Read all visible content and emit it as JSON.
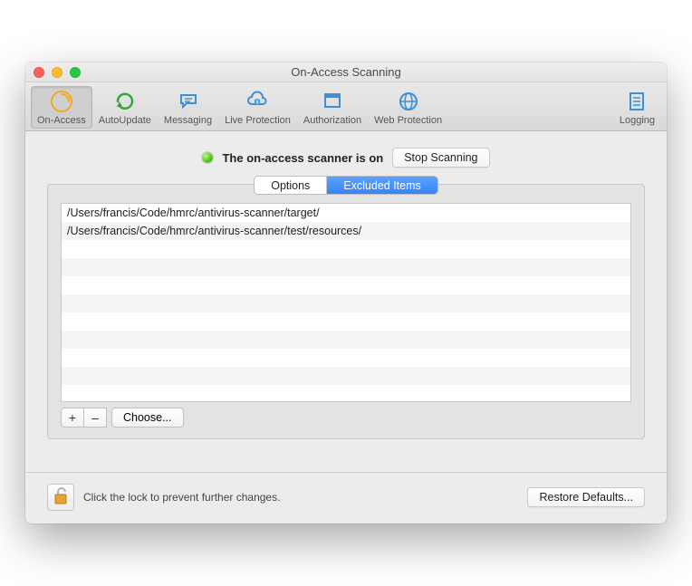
{
  "window": {
    "title": "On-Access Scanning"
  },
  "toolbar": {
    "items": [
      {
        "label": "On-Access",
        "selected": true
      },
      {
        "label": "AutoUpdate",
        "selected": false
      },
      {
        "label": "Messaging",
        "selected": false
      },
      {
        "label": "Live Protection",
        "selected": false
      },
      {
        "label": "Authorization",
        "selected": false
      },
      {
        "label": "Web Protection",
        "selected": false
      }
    ],
    "right": {
      "label": "Logging"
    }
  },
  "status": {
    "text": "The on-access scanner is on",
    "stop_button": "Stop Scanning"
  },
  "tabs": {
    "options": "Options",
    "excluded": "Excluded Items",
    "selected": "excluded"
  },
  "excluded_items": [
    "/Users/francis/Code/hmrc/antivirus-scanner/target/",
    "/Users/francis/Code/hmrc/antivirus-scanner/test/resources/"
  ],
  "list_controls": {
    "add": "+",
    "remove": "–",
    "choose": "Choose..."
  },
  "footer": {
    "lock_text": "Click the lock to prevent further changes.",
    "restore": "Restore Defaults..."
  }
}
